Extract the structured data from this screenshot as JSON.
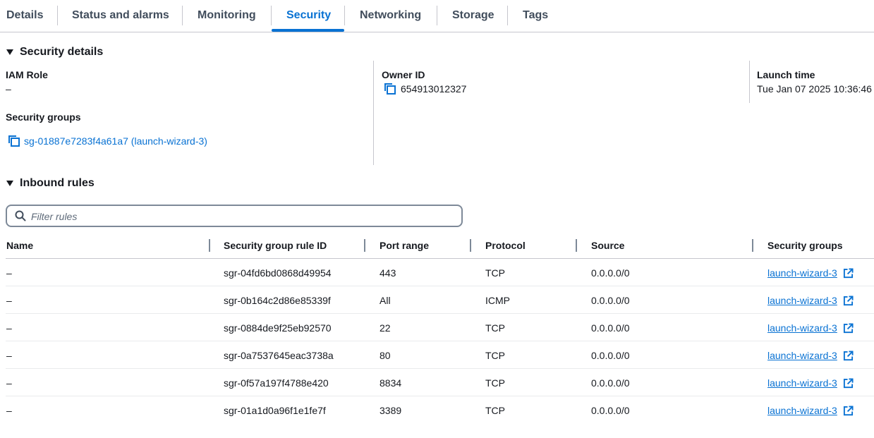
{
  "tabs": [
    {
      "label": "Details"
    },
    {
      "label": "Status and alarms"
    },
    {
      "label": "Monitoring"
    },
    {
      "label": "Security",
      "active": true
    },
    {
      "label": "Networking"
    },
    {
      "label": "Storage"
    },
    {
      "label": "Tags"
    }
  ],
  "security_details": {
    "title": "Security details",
    "iam_role": {
      "label": "IAM Role",
      "value": "–"
    },
    "owner_id": {
      "label": "Owner ID",
      "value": "654913012327"
    },
    "launch_time": {
      "label": "Launch time",
      "value": "Tue Jan 07 2025 10:36:46"
    },
    "security_groups": {
      "label": "Security groups",
      "value": "sg-01887e7283f4a61a7 (launch-wizard-3)"
    }
  },
  "inbound_rules": {
    "title": "Inbound rules",
    "filter_placeholder": "Filter rules",
    "columns": [
      "Name",
      "Security group rule ID",
      "Port range",
      "Protocol",
      "Source",
      "Security groups"
    ],
    "rows": [
      {
        "name": "–",
        "rule_id": "sgr-04fd6bd0868d49954",
        "port": "443",
        "protocol": "TCP",
        "source": "0.0.0.0/0",
        "sg": "launch-wizard-3"
      },
      {
        "name": "–",
        "rule_id": "sgr-0b164c2d86e85339f",
        "port": "All",
        "protocol": "ICMP",
        "source": "0.0.0.0/0",
        "sg": "launch-wizard-3"
      },
      {
        "name": "–",
        "rule_id": "sgr-0884de9f25eb92570",
        "port": "22",
        "protocol": "TCP",
        "source": "0.0.0.0/0",
        "sg": "launch-wizard-3"
      },
      {
        "name": "–",
        "rule_id": "sgr-0a7537645eac3738a",
        "port": "80",
        "protocol": "TCP",
        "source": "0.0.0.0/0",
        "sg": "launch-wizard-3"
      },
      {
        "name": "–",
        "rule_id": "sgr-0f57a197f4788e420",
        "port": "8834",
        "protocol": "TCP",
        "source": "0.0.0.0/0",
        "sg": "launch-wizard-3"
      },
      {
        "name": "–",
        "rule_id": "sgr-01a1d0a96f1e1fe7f",
        "port": "3389",
        "protocol": "TCP",
        "source": "0.0.0.0/0",
        "sg": "launch-wizard-3"
      }
    ]
  },
  "colors": {
    "link": "#0972d3",
    "text": "#16191f",
    "tab_text": "#414d5c",
    "divider": "#c6c6cd"
  },
  "icons": {
    "copy": "copy-icon",
    "search": "search-icon",
    "external": "external-link-icon",
    "caret": "caret-down-icon"
  }
}
